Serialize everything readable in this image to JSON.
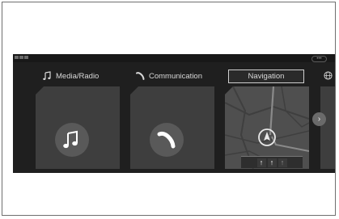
{
  "tabs": {
    "media": "Media/Radio",
    "communication": "Communication",
    "navigation": "Navigation"
  },
  "status": {
    "indicator": "•••"
  },
  "navigation_card": {
    "lanes": [
      "↑",
      "↑",
      "↑"
    ]
  },
  "next_button": "›",
  "colors": {
    "screen_bg": "#1f1f1f",
    "card_bg": "#3e3e3e",
    "icon_circle": "#595959",
    "text": "#d8d8d8"
  },
  "icons": {
    "media": "music-note-icon",
    "communication": "phone-handset-icon",
    "language": "globe-icon"
  }
}
